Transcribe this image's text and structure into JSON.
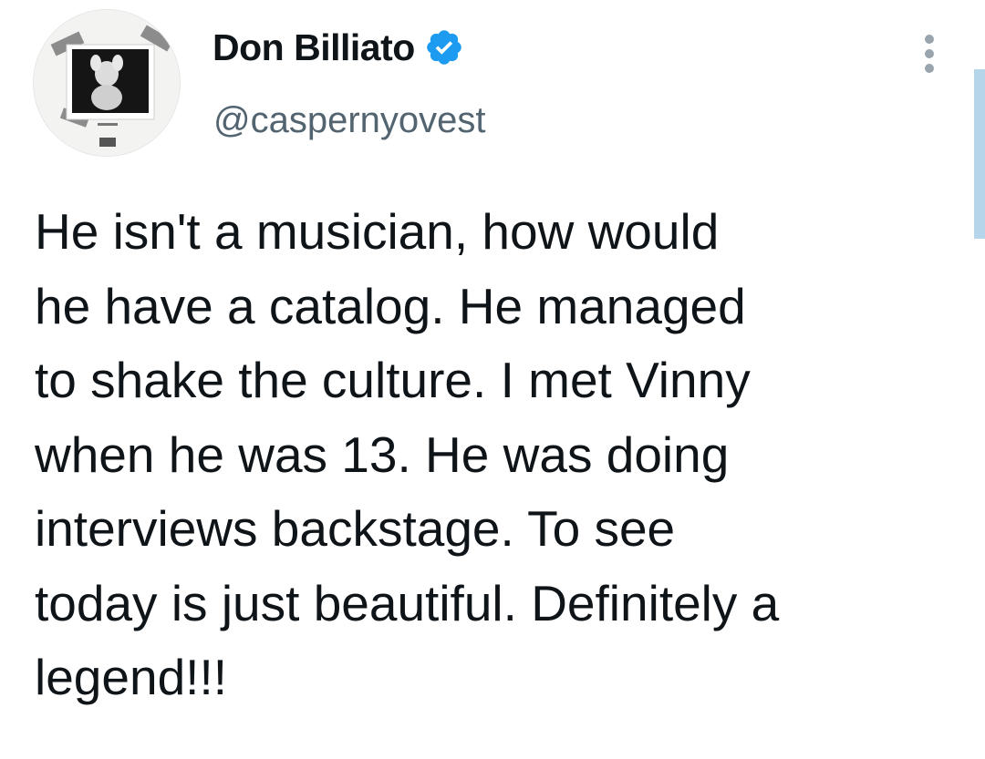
{
  "author": {
    "display_name": "Don Billiato",
    "handle": "@caspernyovest",
    "verified": true,
    "verified_icon": "verified-badge-icon",
    "avatar_icon": "album-cover-avatar"
  },
  "menu": {
    "more_icon": "more-vertical-icon"
  },
  "tweet": {
    "text": "He isn't a musician,  how would\nhe have a catalog. He managed\nto shake the culture. I met Vinny\nwhen he was 13. He was doing\ninterviews backstage. To see\ntoday is just beautiful. Definitely a\nlegend!!!"
  },
  "colors": {
    "text": "#0f1419",
    "secondary": "#536471",
    "verified_blue": "#1d9bf0",
    "scrollbar": "#b5d6ea"
  }
}
